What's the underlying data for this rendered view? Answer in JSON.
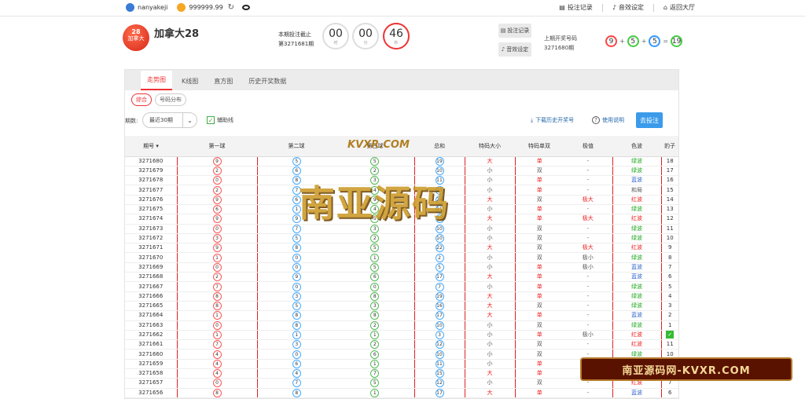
{
  "topbar": {
    "username": "nanyakeji",
    "balance": "999999.99",
    "bet_record": "投注记录",
    "sound": "音效设定",
    "back": "返回大厅"
  },
  "header": {
    "logo_num": "28",
    "logo_sub": "加拿大",
    "title": "加拿大28",
    "period_label": "本期投注截止",
    "period": "第3271681期",
    "cd_h": "00",
    "cd_h_unit": "时",
    "cd_m": "00",
    "cd_m_unit": "分",
    "cd_s": "46",
    "cd_s_unit": "秒",
    "btn_record": "投注记录",
    "btn_sound": "音效设定",
    "last_label": "上期开奖号码",
    "last_period": "3271680期",
    "last_balls": [
      "9",
      "5",
      "5",
      "19"
    ]
  },
  "tabs": [
    "走势图",
    "K线图",
    "直方图",
    "历史开奖数据"
  ],
  "subtabs": [
    "综合",
    "号码分布"
  ],
  "filters": {
    "period_label": "期数:",
    "period_select": "最近30期",
    "aux_label": "辅助线",
    "download": "下载历史开奖号",
    "help": "使用说明",
    "bet": "去投注"
  },
  "table": {
    "headers": [
      "期号 ▾",
      "第一球",
      "第二球",
      "第三球",
      "总和",
      "特码大小",
      "特码单双",
      "极值",
      "色波",
      "豹子"
    ],
    "rows": [
      [
        "3271680",
        "9",
        "5",
        "5",
        "19",
        "大",
        "单",
        "-",
        "绿波",
        "18"
      ],
      [
        "3271679",
        "2",
        "6",
        "2",
        "10",
        "小",
        "双",
        "-",
        "绿波",
        "17"
      ],
      [
        "3271678",
        "0",
        "8",
        "3",
        "11",
        "小",
        "单",
        "-",
        "蓝波",
        "16"
      ],
      [
        "3271677",
        "2",
        "7",
        "4",
        "13",
        "小",
        "单",
        "-",
        "和局",
        "15"
      ],
      [
        "3271676",
        "9",
        "6",
        "9",
        "24",
        "大",
        "双",
        "极大",
        "红波",
        "14"
      ],
      [
        "3271675",
        "6",
        "1",
        "4",
        "11",
        "小",
        "单",
        "-",
        "绿波",
        "13"
      ],
      [
        "3271674",
        "9",
        "9",
        "5",
        "23",
        "大",
        "单",
        "极大",
        "红波",
        "12"
      ],
      [
        "3271673",
        "0",
        "7",
        "3",
        "10",
        "小",
        "双",
        "-",
        "绿波",
        "11"
      ],
      [
        "3271672",
        "3",
        "5",
        "2",
        "10",
        "小",
        "双",
        "-",
        "绿波",
        "10"
      ],
      [
        "3271671",
        "9",
        "8",
        "5",
        "22",
        "大",
        "双",
        "极大",
        "红波",
        "9"
      ],
      [
        "3271670",
        "1",
        "0",
        "1",
        "2",
        "小",
        "双",
        "极小",
        "绿波",
        "8"
      ],
      [
        "3271669",
        "0",
        "0",
        "5",
        "5",
        "小",
        "单",
        "极小",
        "蓝波",
        "7"
      ],
      [
        "3271668",
        "2",
        "9",
        "6",
        "17",
        "大",
        "单",
        "-",
        "蓝波",
        "6"
      ],
      [
        "3271667",
        "7",
        "0",
        "0",
        "7",
        "小",
        "单",
        "-",
        "绿波",
        "5"
      ],
      [
        "3271666",
        "8",
        "3",
        "8",
        "19",
        "大",
        "单",
        "-",
        "绿波",
        "4"
      ],
      [
        "3271665",
        "8",
        "5",
        "3",
        "16",
        "大",
        "双",
        "-",
        "绿波",
        "3"
      ],
      [
        "3271664",
        "1",
        "8",
        "8",
        "17",
        "大",
        "单",
        "-",
        "蓝波",
        "2"
      ],
      [
        "3271663",
        "0",
        "8",
        "2",
        "10",
        "小",
        "双",
        "-",
        "绿波",
        "1"
      ],
      [
        "3271662",
        "1",
        "1",
        "1",
        "3",
        "小",
        "单",
        "极小",
        "红波",
        "✓"
      ],
      [
        "3271661",
        "7",
        "3",
        "2",
        "12",
        "小",
        "双",
        "-",
        "红波",
        "11"
      ],
      [
        "3271660",
        "4",
        "0",
        "6",
        "10",
        "小",
        "双",
        "-",
        "绿波",
        "10"
      ],
      [
        "3271659",
        "4",
        "6",
        "1",
        "11",
        "小",
        "单",
        "-",
        "绿波",
        "9"
      ],
      [
        "3271658",
        "4",
        "4",
        "7",
        "15",
        "大",
        "单",
        "-",
        "蓝波",
        "8"
      ],
      [
        "3271657",
        "0",
        "7",
        "5",
        "12",
        "小",
        "双",
        "-",
        "红波",
        "7"
      ],
      [
        "3271656",
        "8",
        "8",
        "1",
        "17",
        "大",
        "单",
        "-",
        "蓝波",
        "6"
      ]
    ]
  },
  "watermark": {
    "top": "KVXR.COM",
    "main": "南亚源码"
  },
  "banner": "南亚源码网-KVXR.COM"
}
